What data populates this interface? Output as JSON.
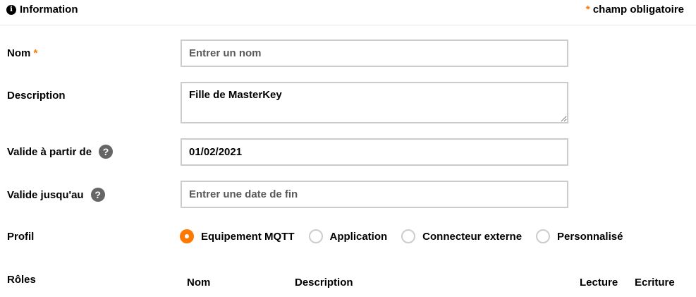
{
  "header": {
    "title": "Information",
    "info_icon": "info-circle-icon",
    "required_star": "*",
    "required_note": "champ obligatoire"
  },
  "form": {
    "name": {
      "label": "Nom",
      "required_star": "*",
      "value": "",
      "placeholder": "Entrer un nom"
    },
    "description": {
      "label": "Description",
      "value": "Fille de MasterKey"
    },
    "valid_from": {
      "label": "Valide à partir de",
      "help_icon": "question-circle-icon",
      "help_glyph": "?",
      "value": "01/02/2021"
    },
    "valid_until": {
      "label": "Valide jusqu'au",
      "help_icon": "question-circle-icon",
      "help_glyph": "?",
      "value": "",
      "placeholder": "Entrer une date de fin"
    },
    "profile": {
      "label": "Profil",
      "options": [
        "Equipement MQTT",
        "Application",
        "Connecteur externe",
        "Personnalisé"
      ],
      "selected": "Equipement MQTT"
    },
    "roles": {
      "label": "Rôles",
      "columns": [
        "Nom",
        "Description",
        "Lecture",
        "Ecriture"
      ]
    }
  },
  "colors": {
    "accent": "#ff7900",
    "border": "#cccccc",
    "help_icon": "#666666"
  }
}
